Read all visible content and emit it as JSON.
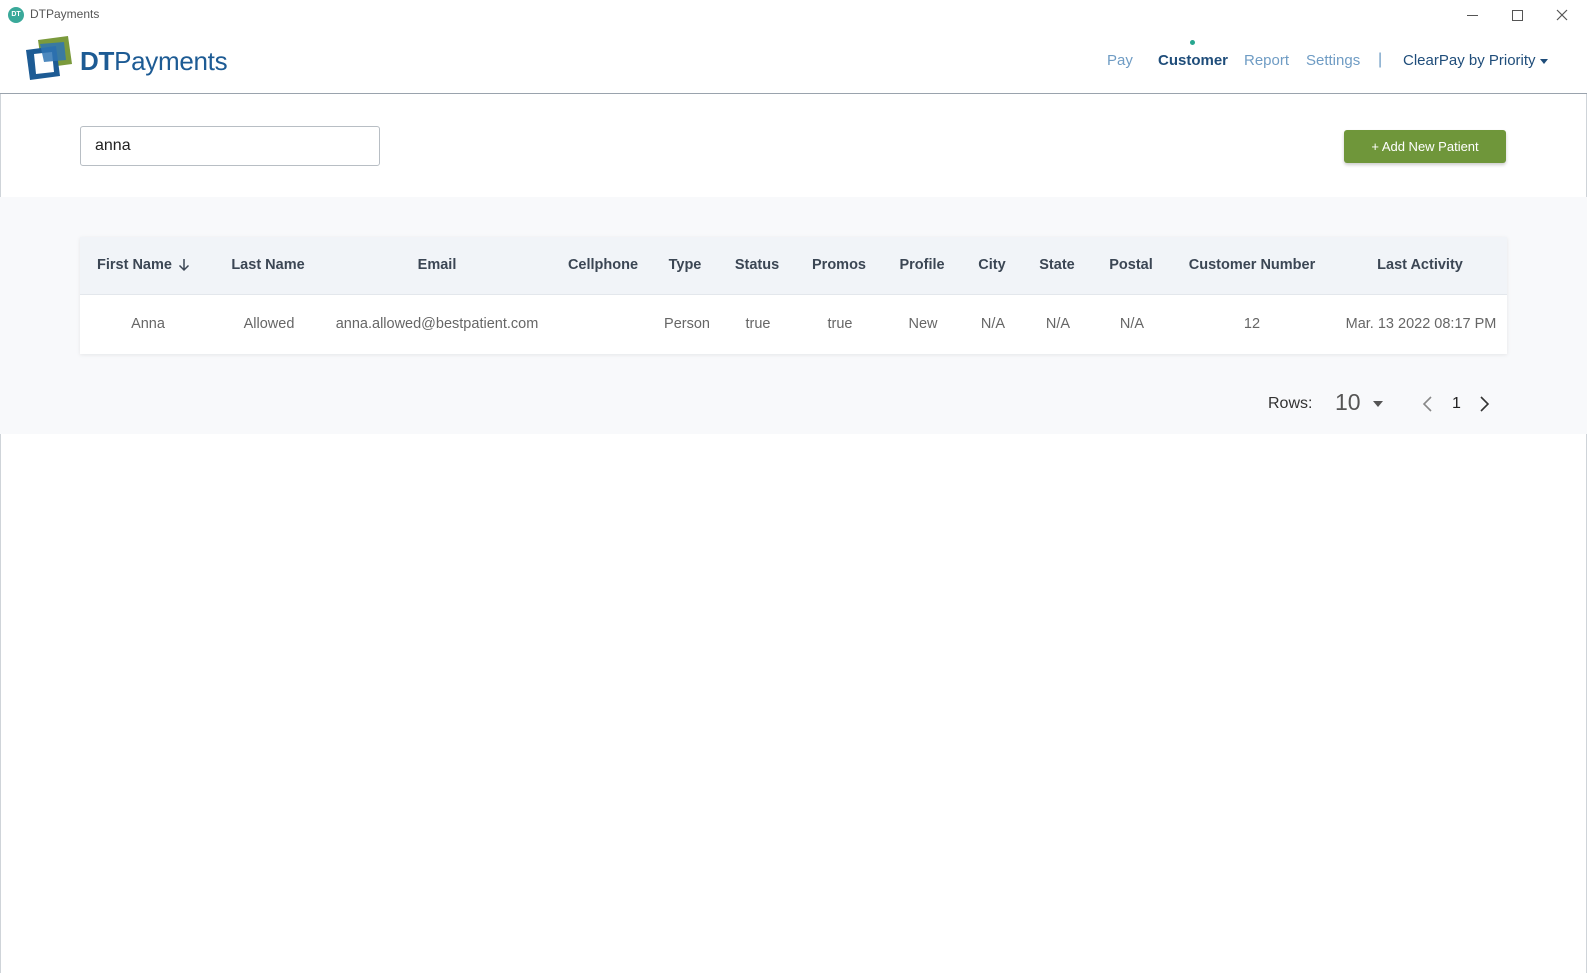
{
  "window": {
    "icon_text": "DT",
    "title": "DTPayments"
  },
  "header": {
    "logo_bold": "DT",
    "logo_rest": "Payments",
    "nav": [
      {
        "label": "Pay",
        "active": false
      },
      {
        "label": "Customer",
        "active": true
      },
      {
        "label": "Report",
        "active": false
      },
      {
        "label": "Settings",
        "active": false
      }
    ],
    "separator": "|",
    "merchant": "ClearPay by Priority"
  },
  "toolbar": {
    "search_value": "anna",
    "add_button": "+ Add New Patient"
  },
  "table": {
    "columns": [
      "First Name",
      "Last Name",
      "Email",
      "Cellphone",
      "Type",
      "Status",
      "Promos",
      "Profile",
      "City",
      "State",
      "Postal",
      "Customer Number",
      "Last Activity"
    ],
    "sort_column": "First Name",
    "sort_direction": "descending",
    "rows": [
      [
        "Anna",
        "Allowed",
        "anna.allowed@bestpatient.com",
        "",
        "Person",
        "true",
        "true",
        "New",
        "N/A",
        "N/A",
        "N/A",
        "12",
        "Mar. 13 2022 08:17 PM"
      ]
    ]
  },
  "pagination": {
    "rows_label": "Rows:",
    "rows_per_page": "10",
    "current_page": "1"
  },
  "colors": {
    "brand_blue": "#1d5b94",
    "nav_inactive": "#6f9cc4",
    "nav_active": "#1f4d7a",
    "active_dot": "#27a68f",
    "add_button": "#6f963a"
  }
}
